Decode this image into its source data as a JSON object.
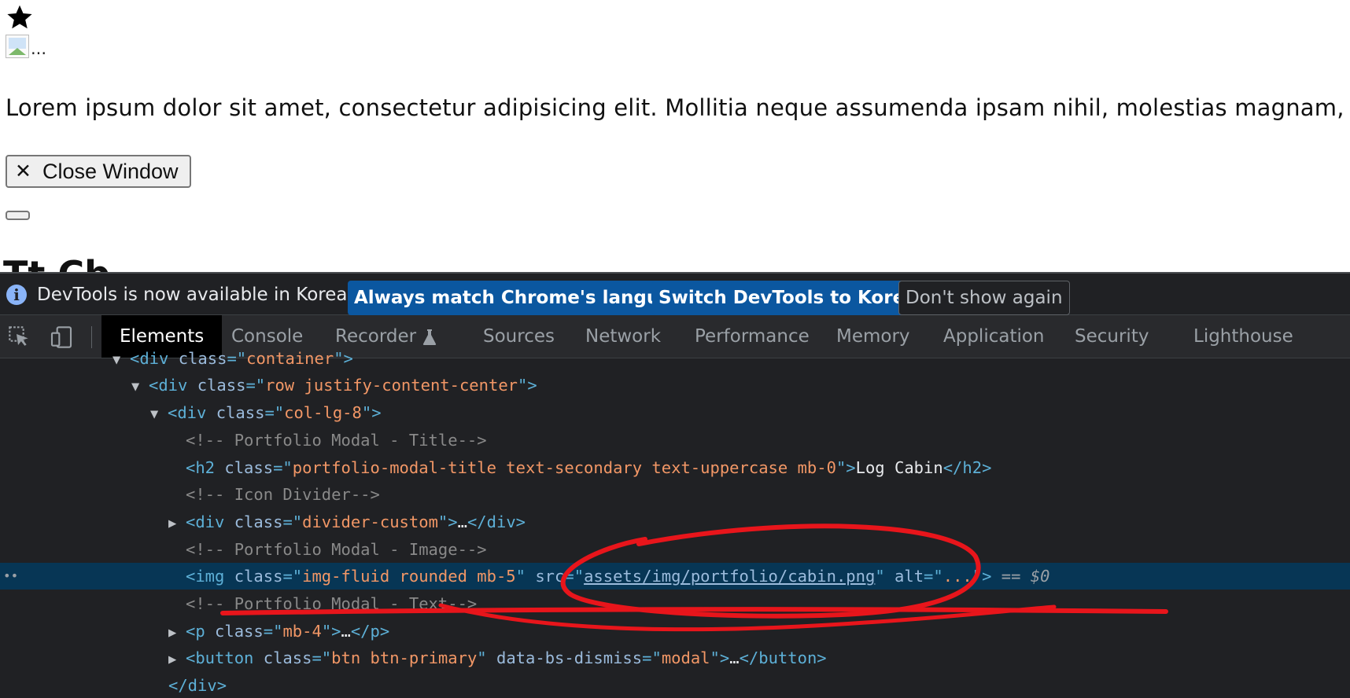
{
  "page": {
    "image_alt": "...",
    "lorem": "Lorem ipsum dolor sit amet, consectetur adipisicing elit. Mollitia neque assumenda ipsam nihil, molestias magnam, re",
    "close_button": {
      "icon": "✕",
      "label": "Close Window"
    },
    "heading_cut": "Tt Cb"
  },
  "infobar": {
    "text": "DevTools is now available in Korean!",
    "btn_match": "Always match Chrome's language",
    "btn_switch": "Switch DevTools to Korean",
    "btn_dont": "Don't show again"
  },
  "tabs": {
    "elements": "Elements",
    "console": "Console",
    "recorder": "Recorder",
    "sources": "Sources",
    "network": "Network",
    "performance": "Performance",
    "memory": "Memory",
    "application": "Application",
    "security": "Security",
    "lighthouse": "Lighthouse"
  },
  "tree": {
    "l1": {
      "open": "<div ",
      "attr": "class",
      "eq": "=\"",
      "val": "container",
      "close": "\">"
    },
    "l2": {
      "open": "<div ",
      "attr": "class",
      "eq": "=\"",
      "val": "row justify-content-center",
      "close": "\">"
    },
    "l3": {
      "open": "<div ",
      "attr": "class",
      "eq": "=\"",
      "val": "col-lg-8",
      "close": "\">"
    },
    "l4": "<!-- Portfolio Modal - Title-->",
    "l5": {
      "open": "<h2 ",
      "attr": "class",
      "eq": "=\"",
      "val": "portfolio-modal-title text-secondary text-uppercase mb-0",
      "mid": "\">",
      "text": "Log Cabin",
      "close": "</h2>"
    },
    "l6": "<!-- Icon Divider-->",
    "l7": {
      "open": "<div ",
      "attr": "class",
      "eq": "=\"",
      "val": "divider-custom",
      "mid": "\">",
      "text": "…",
      "close": "</div>"
    },
    "l8": "<!-- Portfolio Modal - Image-->",
    "l9": {
      "open": "<img ",
      "attr1": "class",
      "eq1": "=\"",
      "val1": "img-fluid rounded mb-5",
      "q1": "\" ",
      "attr2": "src",
      "eq2": "=\"",
      "val2": "assets/img/portfolio/cabin.png",
      "q2": "\" ",
      "attr3": "alt",
      "eq3": "=\"",
      "val3": "...",
      "close": "\">",
      "dollar": " == $0"
    },
    "l10": "<!-- Portfolio Modal - Text-->",
    "l11": {
      "open": "<p ",
      "attr": "class",
      "eq": "=\"",
      "val": "mb-4",
      "mid": "\">",
      "text": "…",
      "close": "</p>"
    },
    "l12": {
      "open": "<button ",
      "attr1": "class",
      "eq1": "=\"",
      "val1": "btn btn-primary",
      "q1": "\" ",
      "attr2": "data-bs-dismiss",
      "eq2": "=\"",
      "val2": "modal",
      "mid": "\">",
      "text": "…",
      "close": "</button>"
    },
    "selected_dots": "••"
  },
  "colors": {
    "devtools_bg": "#202124",
    "selected_row": "#073655",
    "primary_btn": "#0b57a0",
    "annotation": "#e8151b"
  }
}
